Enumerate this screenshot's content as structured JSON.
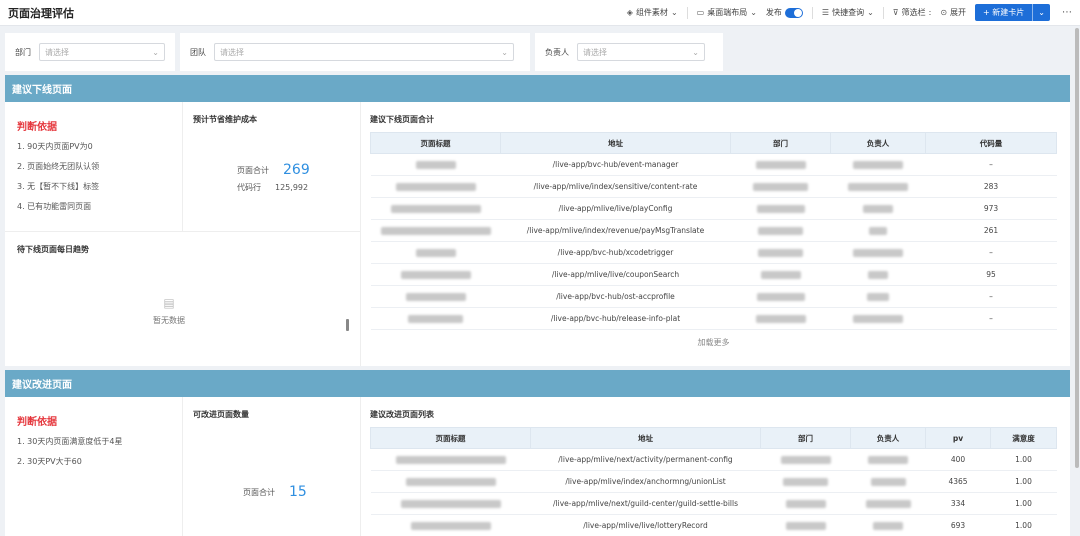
{
  "header": {
    "title": "页面治理评估",
    "tools": {
      "component": "组件素材",
      "desktop_layout": "桌面端布局",
      "publish": "发布",
      "quick_query": "快捷查询",
      "filter": "筛选栏",
      "expand": "展开",
      "new_card": "+ 新建卡片"
    }
  },
  "filters": {
    "dept_label": "部门",
    "dept_placeholder": "请选择",
    "team_label": "团队",
    "team_placeholder": "请选择",
    "owner_label": "负责人",
    "owner_placeholder": "请选择"
  },
  "offline": {
    "section_title": "建议下线页面",
    "basis_title": "判断依据",
    "criteria": [
      "1. 90天内页面PV为0",
      "2. 页面始终无团队认领",
      "3. 无【暂不下线】标签",
      "4. 已有功能雷同页面"
    ],
    "cost_title": "预计节省维护成本",
    "page_total_label": "页面合计",
    "page_total": "269",
    "code_lines_label": "代码行",
    "code_lines": "125,992",
    "trend_title": "待下线页面每日趋势",
    "no_data": "暂无数据",
    "table_title": "建议下线页面合计",
    "columns": [
      "页面标题",
      "地址",
      "部门",
      "负责人",
      "代码量"
    ],
    "rows": [
      {
        "addr": "/live-app/bvc-hub/event-manager",
        "code": "–"
      },
      {
        "addr": "/live-app/mlive/index/sensitive/content-rate",
        "code": "283"
      },
      {
        "addr": "/live-app/mlive/live/playConfig",
        "code": "973"
      },
      {
        "addr": "/live-app/mlive/index/revenue/payMsgTranslate",
        "code": "261"
      },
      {
        "addr": "/live-app/bvc-hub/xcodetrigger",
        "code": "–"
      },
      {
        "addr": "/live-app/mlive/live/couponSearch",
        "code": "95"
      },
      {
        "addr": "/live-app/bvc-hub/ost-accprofile",
        "code": "–"
      },
      {
        "addr": "/live-app/bvc-hub/release-info-plat",
        "code": "–"
      }
    ],
    "load_more": "加载更多"
  },
  "improve": {
    "section_title": "建议改进页面",
    "basis_title": "判断依据",
    "criteria": [
      "1. 30天内页面满意度低于4星",
      "2. 30天PV大于60"
    ],
    "count_title": "可改进页面数量",
    "page_total_label": "页面合计",
    "page_total": "15",
    "table_title": "建议改进页面列表",
    "columns": [
      "页面标题",
      "地址",
      "部门",
      "负责人",
      "pv",
      "满意度"
    ],
    "rows": [
      {
        "addr": "/live-app/mlive/next/activity/permanent-config",
        "pv": "400",
        "sat": "1.00"
      },
      {
        "addr": "/live-app/mlive/index/anchormng/unionList",
        "pv": "4365",
        "sat": "1.00"
      },
      {
        "addr": "/live-app/mlive/next/guild-center/guild-settle-bills",
        "pv": "334",
        "sat": "1.00"
      },
      {
        "addr": "/live-app/mlive/live/lotteryRecord",
        "pv": "693",
        "sat": "1.00"
      }
    ]
  }
}
